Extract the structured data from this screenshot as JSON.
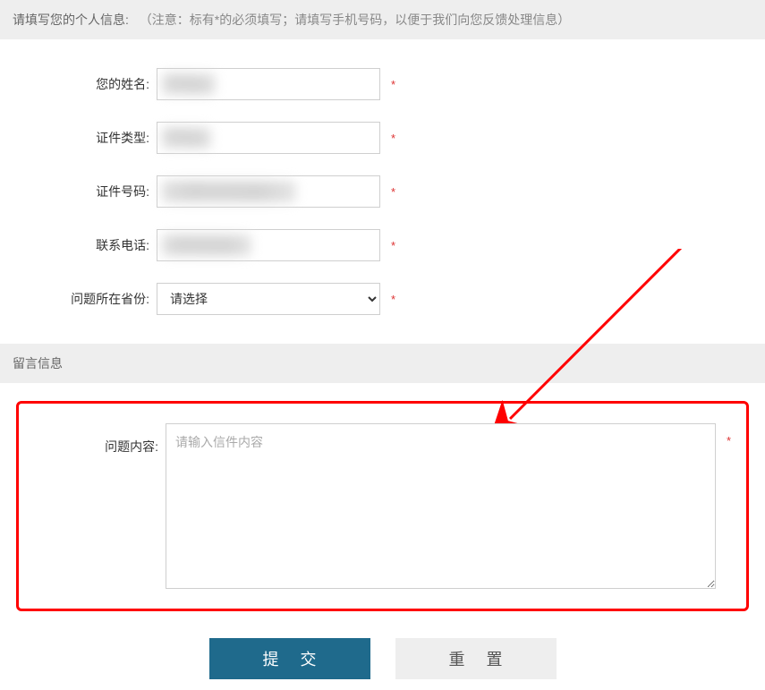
{
  "header1": {
    "title": "请填写您的个人信息:",
    "note": "（注意：标有*的必须填写；请填写手机号码，以便于我们向您反馈处理信息）"
  },
  "fields": {
    "name": {
      "label": "您的姓名:",
      "value": ""
    },
    "idtype": {
      "label": "证件类型:",
      "value": ""
    },
    "idno": {
      "label": "证件号码:",
      "value": ""
    },
    "phone": {
      "label": "联系电话:",
      "value": ""
    },
    "province": {
      "label": "问题所在省份:",
      "placeholder": "请选择"
    }
  },
  "star": "*",
  "header2": {
    "title": "留言信息"
  },
  "message": {
    "label": "问题内容:",
    "placeholder": "请输入信件内容"
  },
  "buttons": {
    "submit": "提交",
    "reset": "重置"
  }
}
